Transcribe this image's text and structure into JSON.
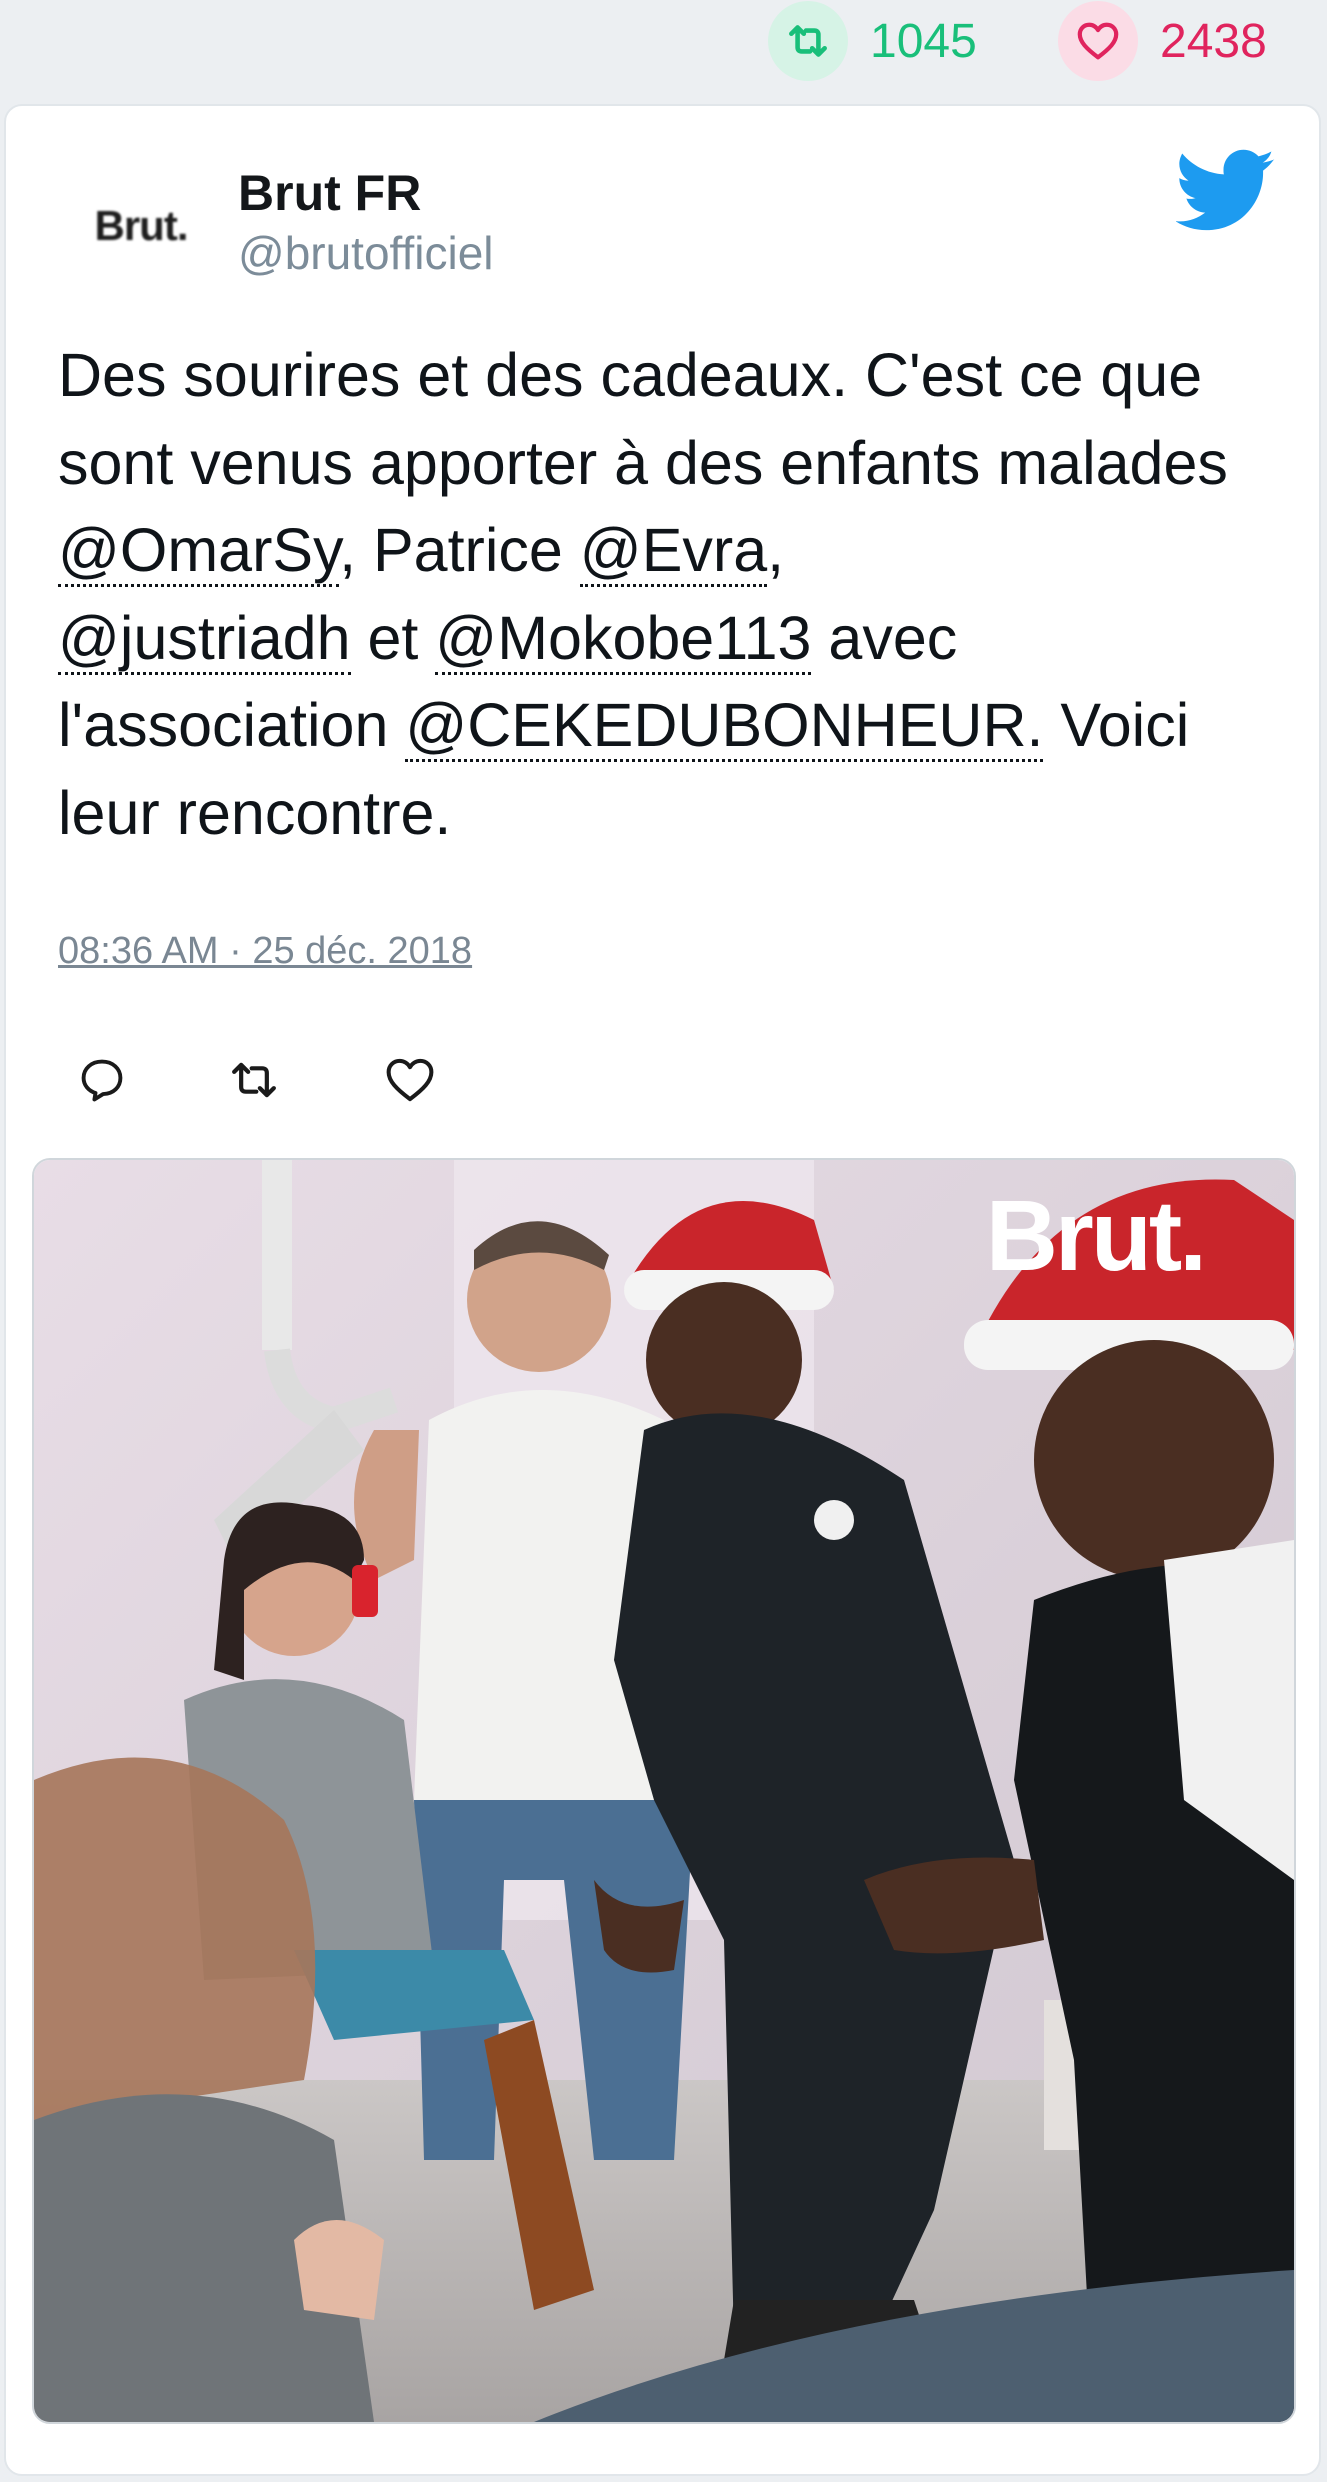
{
  "stats": {
    "retweet_count": "1045",
    "like_count": "2438",
    "retweet_color": "#19bf7a",
    "like_color": "#e0245e"
  },
  "tweet": {
    "avatar_text": "Brut.",
    "author_name": "Brut FR",
    "author_handle": "@brutofficiel",
    "text_parts": {
      "p1": "Des sourires et des cadeaux. C'est ce que sont venus apporter à des enfants malades ",
      "m1": "@OmarSy",
      "p2": ", Patrice ",
      "m2": "@Evra",
      "p3": ", ",
      "m3": "@justriadh",
      "p4": " et ",
      "m4": "@Mokobe113",
      "p5": " avec l'association ",
      "m5": "@CEKEDUBONHEUR.",
      "p6": " Voici leur rencontre."
    },
    "timestamp": "08:36 AM · 25 déc. 2018",
    "actions": {
      "reply_icon": "reply-icon",
      "retweet_icon": "retweet-icon",
      "like_icon": "heart-icon"
    },
    "media": {
      "watermark": "Brut.",
      "icon": "photo"
    }
  },
  "colors": {
    "brand": "#1d9bf0",
    "text": "#0f1419",
    "muted": "#7c8c99"
  }
}
